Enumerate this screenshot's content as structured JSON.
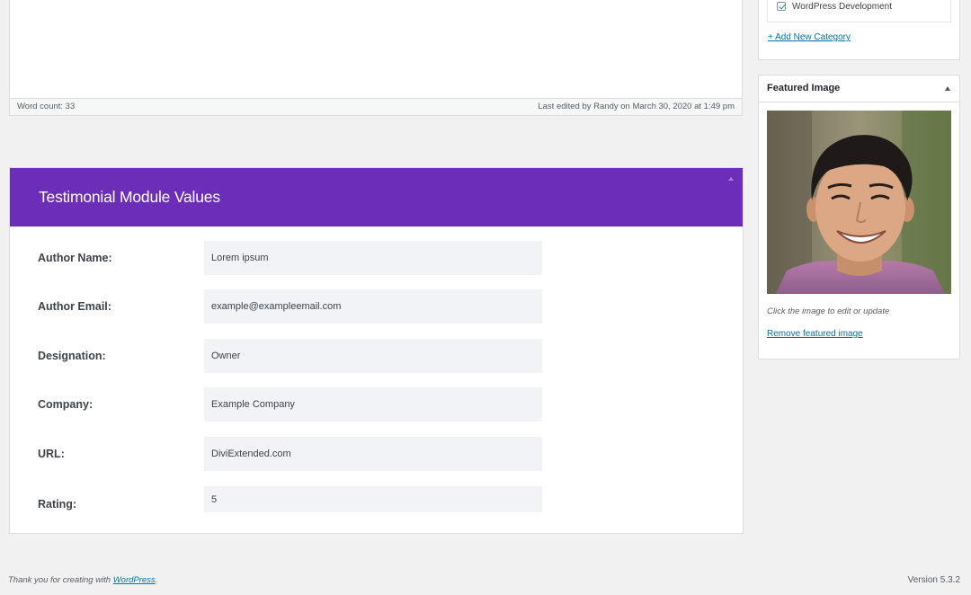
{
  "editor": {
    "word_count": "Word count: 33",
    "last_edited": "Last edited by Randy on March 30, 2020 at 1:49 pm"
  },
  "testimonial": {
    "title": "Testimonial Module Values",
    "fields": [
      {
        "label": "Author Name:",
        "value": "Lorem ipsum"
      },
      {
        "label": "Author Email:",
        "value": "example@exampleemail.com"
      },
      {
        "label": "Designation:",
        "value": "Owner"
      },
      {
        "label": "Company:",
        "value": "Example Company"
      },
      {
        "label": "URL:",
        "value": "DiviExtended.com"
      },
      {
        "label": "Rating:",
        "value": "5"
      }
    ]
  },
  "categories": {
    "checked_item": "WordPress Development",
    "add_new": "+ Add New Category"
  },
  "featured_image": {
    "title": "Featured Image",
    "caption": "Click the image to edit or update",
    "remove_link": "Remove featured image"
  },
  "footer": {
    "thanks_prefix": "Thank you for creating with ",
    "wordpress_link": "WordPress",
    "thanks_suffix": ".",
    "version": "Version 5.3.2"
  },
  "colors": {
    "header_purple": "#6c2eb9",
    "link_blue": "#0073aa",
    "input_bg": "#f1f3f7"
  }
}
